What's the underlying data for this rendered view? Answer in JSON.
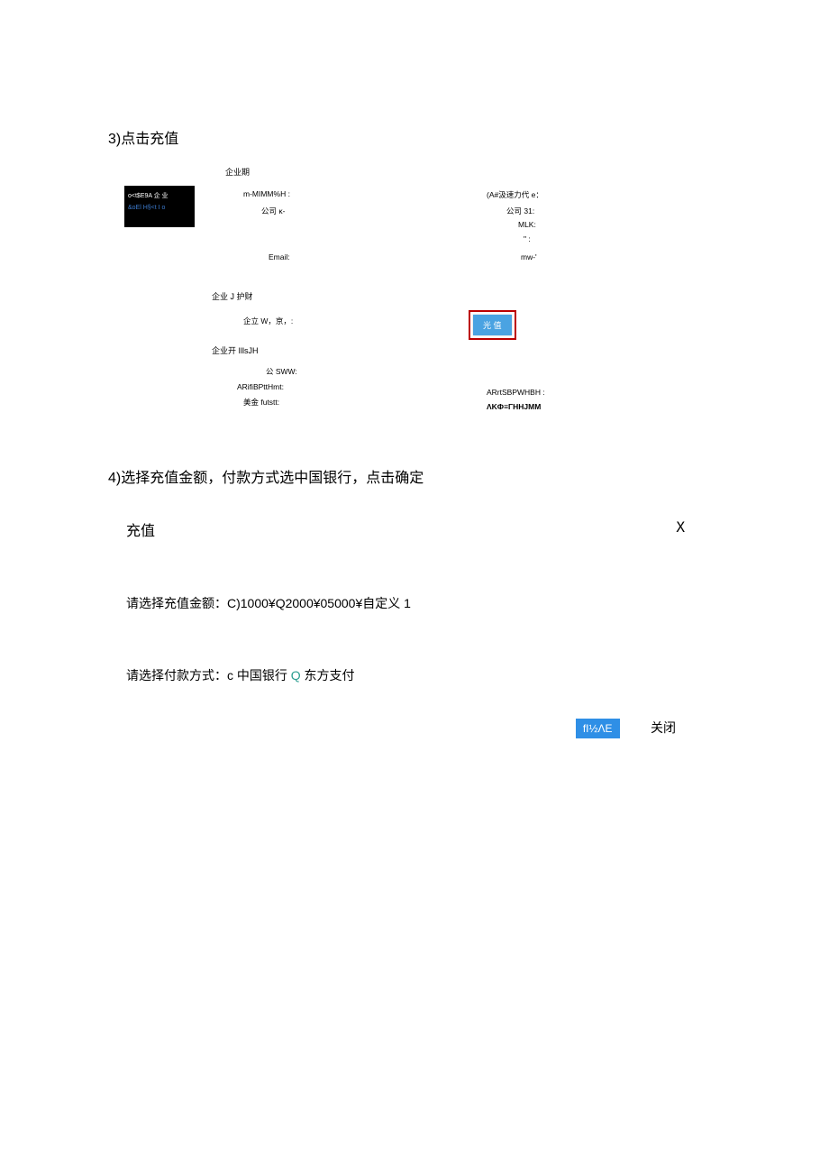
{
  "steps": {
    "s3": "3)点击充值",
    "s4": "4)选择充值金额，付款方式选中国银行，点击确定"
  },
  "panel": {
    "sidebar": {
      "line1": "o<t$E9A 企 业",
      "line2": "&oEl H§<t I o"
    },
    "sections": {
      "info": "企业期",
      "finance": "企业 J 护财",
      "invoice": "企业开 IllsJH"
    },
    "left": {
      "l1": "m-MIMM%H :",
      "l2": "公司 κ-",
      "l3": "Email:",
      "fin1": "企立 W，京，:",
      "inv1": "公 SWW:",
      "inv2": "ARifiBPttHmt:",
      "inv3": "美金 futstt:"
    },
    "right": {
      "r1": "(A#汲速力代 e：",
      "r2": "公司 31:",
      "r3": "MLK:",
      "r4": "\"  :",
      "r5": "mw-'",
      "inv1": "ARrtSBPWHBH :",
      "inv2": "ΛKФ≡ΓHHJMM"
    },
    "recharge_btn": "光 值"
  },
  "modal": {
    "title": "充值",
    "close_x": "X",
    "amount_line": "请选择充值金额：C)1000¥Q2000¥05000¥自定义 1",
    "payment_prefix": "请选择付款方式：c 中国银行",
    "payment_q": "Q",
    "payment_suffix": " 东方支付",
    "confirm": "fI½ΛE",
    "close": "关闭"
  }
}
